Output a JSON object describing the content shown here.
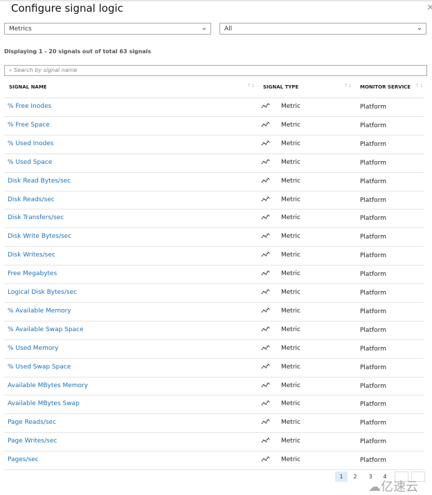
{
  "title": "Configure signal logic",
  "filters": {
    "signal_type": "Metrics",
    "monitor_service": "All"
  },
  "summary": "Displaying 1 - 20 signals out of total 63 signals",
  "search": {
    "placeholder": "Search by signal name",
    "icon": "search-icon"
  },
  "columns": [
    "SIGNAL NAME",
    "SIGNAL TYPE",
    "MONITOR SERVICE"
  ],
  "rows": [
    {
      "name": "% Free Inodes",
      "type": "Metric",
      "service": "Platform"
    },
    {
      "name": "% Free Space",
      "type": "Metric",
      "service": "Platform"
    },
    {
      "name": "% Used Inodes",
      "type": "Metric",
      "service": "Platform"
    },
    {
      "name": "% Used Space",
      "type": "Metric",
      "service": "Platform"
    },
    {
      "name": "Disk Read Bytes/sec",
      "type": "Metric",
      "service": "Platform"
    },
    {
      "name": "Disk Reads/sec",
      "type": "Metric",
      "service": "Platform"
    },
    {
      "name": "Disk Transfers/sec",
      "type": "Metric",
      "service": "Platform"
    },
    {
      "name": "Disk Write Bytes/sec",
      "type": "Metric",
      "service": "Platform"
    },
    {
      "name": "Disk Writes/sec",
      "type": "Metric",
      "service": "Platform"
    },
    {
      "name": "Free Megabytes",
      "type": "Metric",
      "service": "Platform"
    },
    {
      "name": "Logical Disk Bytes/sec",
      "type": "Metric",
      "service": "Platform"
    },
    {
      "name": "% Available Memory",
      "type": "Metric",
      "service": "Platform"
    },
    {
      "name": "% Available Swap Space",
      "type": "Metric",
      "service": "Platform"
    },
    {
      "name": "% Used Memory",
      "type": "Metric",
      "service": "Platform"
    },
    {
      "name": "% Used Swap Space",
      "type": "Metric",
      "service": "Platform"
    },
    {
      "name": "Available MBytes Memory",
      "type": "Metric",
      "service": "Platform"
    },
    {
      "name": "Available MBytes Swap",
      "type": "Metric",
      "service": "Platform"
    },
    {
      "name": "Page Reads/sec",
      "type": "Metric",
      "service": "Platform"
    },
    {
      "name": "Page Writes/sec",
      "type": "Metric",
      "service": "Platform"
    },
    {
      "name": "Pages/sec",
      "type": "Metric",
      "service": "Platform"
    }
  ],
  "pagination": {
    "pages": [
      "1",
      "2",
      "3",
      "4"
    ],
    "current": "1"
  },
  "watermark": "亿速云",
  "colors": {
    "link": "#1f6fb5",
    "current_page": "#deecf9"
  }
}
